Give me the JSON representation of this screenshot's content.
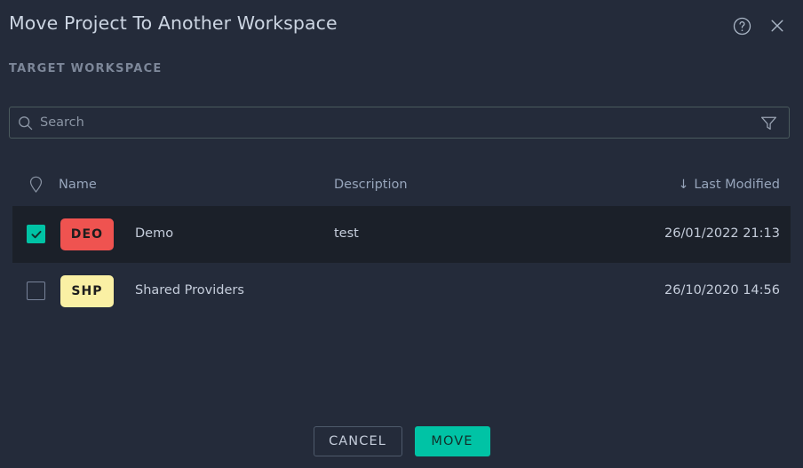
{
  "header": {
    "title": "Move Project To Another Workspace",
    "help_icon": "help-circle-icon",
    "close_icon": "close-icon"
  },
  "section": {
    "label": "TARGET WORKSPACE"
  },
  "search": {
    "value": "",
    "placeholder": "Search",
    "search_icon": "search-icon",
    "filter_icon": "filter-funnel-icon"
  },
  "table": {
    "pin_icon": "location-pin-icon",
    "columns": {
      "name": "Name",
      "description": "Description",
      "last_modified": "Last Modified",
      "sort_arrow": "↓"
    },
    "rows": [
      {
        "selected": true,
        "badge": "DEO",
        "badge_color": "#ef5350",
        "badge_text_color": "#1d1d1d",
        "name": "Demo",
        "description": "test",
        "last_modified": "26/01/2022 21:13"
      },
      {
        "selected": false,
        "badge": "SHP",
        "badge_color": "#faf0a4",
        "badge_text_color": "#1d1d1d",
        "name": "Shared Providers",
        "description": "",
        "last_modified": "26/10/2020 14:56"
      }
    ]
  },
  "footer": {
    "cancel_label": "CANCEL",
    "move_label": "MOVE"
  },
  "colors": {
    "background": "#242b3a",
    "selected_row": "#1b2029",
    "accent_teal": "#00c3a5",
    "muted_text": "#7d8799"
  }
}
